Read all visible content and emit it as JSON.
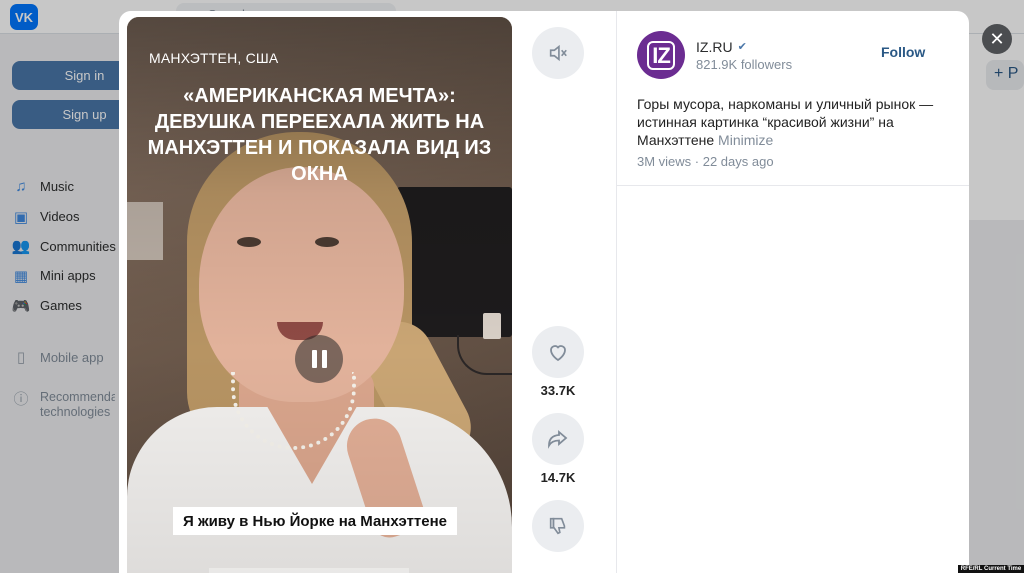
{
  "background": {
    "search_placeholder": "Search",
    "sign_in": "Sign in",
    "sign_up": "Sign up",
    "menu": [
      {
        "label": "Music",
        "icon": "music-icon"
      },
      {
        "label": "Videos",
        "icon": "video-icon"
      },
      {
        "label": "Communities",
        "icon": "communities-icon"
      },
      {
        "label": "Mini apps",
        "icon": "mini-apps-icon"
      },
      {
        "label": "Games",
        "icon": "games-icon"
      }
    ],
    "mobile_app": "Mobile app",
    "recommendation": "Recommendation technologies",
    "right_button": "+ P"
  },
  "video": {
    "location": "МАНХЭТТЕН, США",
    "headline": "«АМЕРИКАНСКАЯ МЕЧТА»: ДЕВУШКА ПЕРЕЕХАЛА ЖИТЬ НА МАНХЭТТЕН И ПОКАЗАЛА ВИД ИЗ ОКНА",
    "caption": "Я живу в Нью Йорке на Манхэттене"
  },
  "actions": {
    "likes": "33.7K",
    "shares": "14.7K"
  },
  "channel": {
    "avatar_text": "IZ",
    "name": "IZ.RU",
    "followers": "821.9K followers",
    "follow": "Follow",
    "description": "Горы мусора, наркоманы и уличный рынок — истинная картинка “красивой жизни” на Манхэттене",
    "minimize": "Minimize",
    "meta": "3M views · 22 days ago"
  },
  "watermark": "RFE/RL Current Time"
}
